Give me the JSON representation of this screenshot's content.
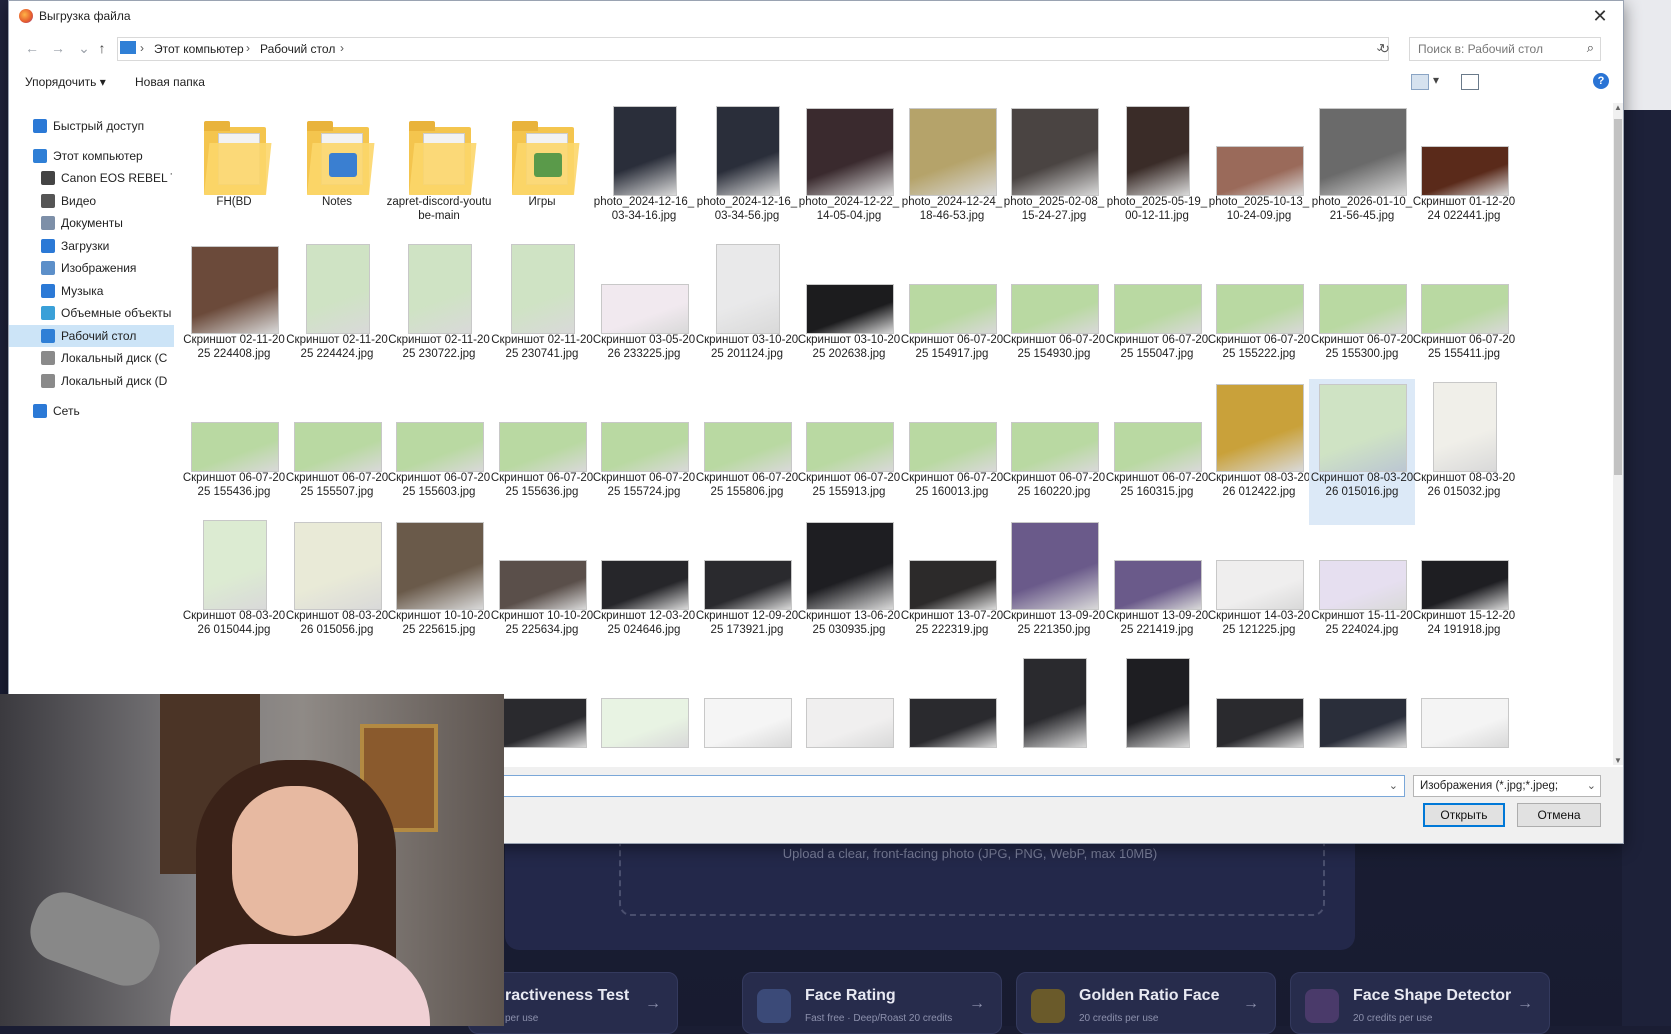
{
  "dialog": {
    "title": "Выгрузка файла",
    "close_label": "✕",
    "breadcrumb": [
      "Этот компьютер",
      "Рабочий стол"
    ],
    "search_placeholder": "Поиск в: Рабочий стол",
    "toolbar": {
      "organize": "Упорядочить",
      "new_folder": "Новая папка",
      "help": "?"
    },
    "nav": [
      {
        "label": "Быстрый доступ",
        "icon": "star-icon",
        "color": "#2b79d6"
      },
      {
        "label": "Этот компьютер",
        "icon": "computer-icon",
        "color": "#2f7fd6"
      },
      {
        "label": "Canon EOS REBEL T",
        "icon": "camera-icon",
        "color": "#444444"
      },
      {
        "label": "Видео",
        "icon": "video-icon",
        "color": "#555555"
      },
      {
        "label": "Документы",
        "icon": "documents-icon",
        "color": "#7d8fa8"
      },
      {
        "label": "Загрузки",
        "icon": "downloads-icon",
        "color": "#2b79d6"
      },
      {
        "label": "Изображения",
        "icon": "images-icon",
        "color": "#5c8fc9"
      },
      {
        "label": "Музыка",
        "icon": "music-icon",
        "color": "#2b79d6"
      },
      {
        "label": "Объемные объекты",
        "icon": "3d-objects-icon",
        "color": "#3aa0d8"
      },
      {
        "label": "Рабочий стол",
        "icon": "desktop-icon",
        "color": "#2f7fd6"
      },
      {
        "label": "Локальный диск (C",
        "icon": "drive-icon",
        "color": "#8a8a8a"
      },
      {
        "label": "Локальный диск (D",
        "icon": "drive-icon",
        "color": "#8a8a8a"
      },
      {
        "label": "Сеть",
        "icon": "network-icon",
        "color": "#2b79d6"
      }
    ],
    "files": [
      [
        {
          "name": "FH(BD",
          "kind": "folder"
        },
        {
          "name": "Notes",
          "kind": "folder",
          "badge": "#3a7fd1"
        },
        {
          "name": "zapret-discord-youtube-main",
          "kind": "folder"
        },
        {
          "name": "Игры",
          "kind": "folder",
          "badge": "#5a9a4a"
        },
        {
          "name": "photo_2024-12-16_03-34-16.jpg",
          "kind": "image",
          "color": "#2a2e3a",
          "shape": "tall"
        },
        {
          "name": "photo_2024-12-16_03-34-56.jpg",
          "kind": "image",
          "color": "#2a2e3a",
          "shape": "tall"
        },
        {
          "name": "photo_2024-12-22_14-05-04.jpg",
          "kind": "image",
          "color": "#3a2a2e",
          "shape": "square"
        },
        {
          "name": "photo_2024-12-24_18-46-53.jpg",
          "kind": "image",
          "color": "#b5a36a",
          "shape": "square"
        },
        {
          "name": "photo_2025-02-08_15-24-27.jpg",
          "kind": "image",
          "color": "#4a4442",
          "shape": "square"
        },
        {
          "name": "photo_2025-05-19_00-12-11.jpg",
          "kind": "image",
          "color": "#3a2c28",
          "shape": "tall"
        },
        {
          "name": "photo_2025-10-13_10-24-09.jpg",
          "kind": "image",
          "color": "#9a6a5a",
          "shape": "wide"
        },
        {
          "name": "photo_2026-01-10_21-56-45.jpg",
          "kind": "image",
          "color": "#6a6a6a",
          "shape": "square"
        },
        {
          "name": "Скриншот 01-12-2024 022441.jpg",
          "kind": "image",
          "color": "#5a2a1a",
          "shape": "wide"
        }
      ],
      [
        {
          "name": "Скриншот 02-11-2025 224408.jpg",
          "kind": "image",
          "color": "#6b4a3a",
          "shape": "square"
        },
        {
          "name": "Скриншот 02-11-2025 224424.jpg",
          "kind": "image",
          "color": "#cfe3c4",
          "shape": "tall"
        },
        {
          "name": "Скриншот 02-11-2025 230722.jpg",
          "kind": "image",
          "color": "#cfe3c4",
          "shape": "tall"
        },
        {
          "name": "Скриншот 02-11-2025 230741.jpg",
          "kind": "image",
          "color": "#cfe3c4",
          "shape": "tall"
        },
        {
          "name": "Скриншот 03-05-2026 233225.jpg",
          "kind": "image",
          "color": "#f1e9ef",
          "shape": "wide"
        },
        {
          "name": "Скриншот 03-10-2025 201124.jpg",
          "kind": "image",
          "color": "#e9e9ea",
          "shape": "tall"
        },
        {
          "name": "Скриншот 03-10-2025 202638.jpg",
          "kind": "image",
          "color": "#1c1c1e",
          "shape": "wide"
        },
        {
          "name": "Скриншот 06-07-2025 154917.jpg",
          "kind": "image",
          "color": "#b9d9a2",
          "shape": "wide"
        },
        {
          "name": "Скриншот 06-07-2025 154930.jpg",
          "kind": "image",
          "color": "#b9d9a2",
          "shape": "wide"
        },
        {
          "name": "Скриншот 06-07-2025 155047.jpg",
          "kind": "image",
          "color": "#b9d9a2",
          "shape": "wide"
        },
        {
          "name": "Скриншот 06-07-2025 155222.jpg",
          "kind": "image",
          "color": "#b9d9a2",
          "shape": "wide"
        },
        {
          "name": "Скриншот 06-07-2025 155300.jpg",
          "kind": "image",
          "color": "#b9d9a2",
          "shape": "wide"
        },
        {
          "name": "Скриншот 06-07-2025 155411.jpg",
          "kind": "image",
          "color": "#b9d9a2",
          "shape": "wide"
        }
      ],
      [
        {
          "name": "Скриншот 06-07-2025 155436.jpg",
          "kind": "image",
          "color": "#b9d9a2",
          "shape": "wide"
        },
        {
          "name": "Скриншот 06-07-2025 155507.jpg",
          "kind": "image",
          "color": "#b9d9a2",
          "shape": "wide"
        },
        {
          "name": "Скриншот 06-07-2025 155603.jpg",
          "kind": "image",
          "color": "#b9d9a2",
          "shape": "wide"
        },
        {
          "name": "Скриншот 06-07-2025 155636.jpg",
          "kind": "image",
          "color": "#b9d9a2",
          "shape": "wide"
        },
        {
          "name": "Скриншот 06-07-2025 155724.jpg",
          "kind": "image",
          "color": "#b9d9a2",
          "shape": "wide"
        },
        {
          "name": "Скриншот 06-07-2025 155806.jpg",
          "kind": "image",
          "color": "#b9d9a2",
          "shape": "wide"
        },
        {
          "name": "Скриншот 06-07-2025 155913.jpg",
          "kind": "image",
          "color": "#b9d9a2",
          "shape": "wide"
        },
        {
          "name": "Скриншот 06-07-2025 160013.jpg",
          "kind": "image",
          "color": "#b9d9a2",
          "shape": "wide"
        },
        {
          "name": "Скриншот 06-07-2025 160220.jpg",
          "kind": "image",
          "color": "#b9d9a2",
          "shape": "wide"
        },
        {
          "name": "Скриншот 06-07-2025 160315.jpg",
          "kind": "image",
          "color": "#b9d9a2",
          "shape": "wide"
        },
        {
          "name": "Скриншот 08-03-2026 012422.jpg",
          "kind": "image",
          "color": "#c9a13a",
          "shape": "square"
        },
        {
          "name": "Скриншот 08-03-2026 015016.jpg",
          "kind": "image",
          "color": "#cfe3c4",
          "shape": "square",
          "selected": true
        },
        {
          "name": "Скриншот 08-03-2026 015032.jpg",
          "kind": "image",
          "color": "#f0efe9",
          "shape": "tall"
        }
      ],
      [
        {
          "name": "Скриншот 08-03-2026 015044.jpg",
          "kind": "image",
          "color": "#dcebd2",
          "shape": "tall"
        },
        {
          "name": "Скриншот 08-03-2026 015056.jpg",
          "kind": "image",
          "color": "#e9ead7",
          "shape": "square"
        },
        {
          "name": "Скриншот 10-10-2025 225615.jpg",
          "kind": "image",
          "color": "#6a5a4a",
          "shape": "square"
        },
        {
          "name": "Скриншот 10-10-2025 225634.jpg",
          "kind": "image",
          "color": "#5a4f4a",
          "shape": "wide"
        },
        {
          "name": "Скриншот 12-03-2025 024646.jpg",
          "kind": "image",
          "color": "#26262a",
          "shape": "wide"
        },
        {
          "name": "Скриншот 12-09-2025 173921.jpg",
          "kind": "image",
          "color": "#2a2a2e",
          "shape": "wide"
        },
        {
          "name": "Скриншот 13-06-2025 030935.jpg",
          "kind": "image",
          "color": "#1e1e22",
          "shape": "square"
        },
        {
          "name": "Скриншот 13-07-2025 222319.jpg",
          "kind": "image",
          "color": "#2c2a2a",
          "shape": "wide"
        },
        {
          "name": "Скриншот 13-09-2025 221350.jpg",
          "kind": "image",
          "color": "#6a5a8a",
          "shape": "square"
        },
        {
          "name": "Скриншот 13-09-2025 221419.jpg",
          "kind": "image",
          "color": "#6a5a8a",
          "shape": "wide"
        },
        {
          "name": "Скриншот 14-03-2025 121225.jpg",
          "kind": "image",
          "color": "#efeeee",
          "shape": "wide"
        },
        {
          "name": "Скриншот 15-11-2025 224024.jpg",
          "kind": "image",
          "color": "#e6dff0",
          "shape": "wide"
        },
        {
          "name": "Скриншот 15-12-2024 191918.jpg",
          "kind": "image",
          "color": "#1e1e22",
          "shape": "wide"
        }
      ],
      [
        {
          "name": "",
          "kind": "image",
          "color": "#f4f4f4",
          "shape": "wide"
        },
        {
          "name": "",
          "kind": "image",
          "color": "#f4f4f4",
          "shape": "wide"
        },
        {
          "name": "",
          "kind": "image",
          "color": "#f4f4f4",
          "shape": "wide"
        },
        {
          "name": "",
          "kind": "image",
          "color": "#2a2a2e",
          "shape": "wide"
        },
        {
          "name": "",
          "kind": "image",
          "color": "#e8f3e3",
          "shape": "wide"
        },
        {
          "name": "",
          "kind": "image",
          "color": "#f5f5f5",
          "shape": "wide"
        },
        {
          "name": "",
          "kind": "image",
          "color": "#f0efef",
          "shape": "wide"
        },
        {
          "name": "",
          "kind": "image",
          "color": "#2a2a2e",
          "shape": "wide"
        },
        {
          "name": "",
          "kind": "image",
          "color": "#2a2a2e",
          "shape": "tall"
        },
        {
          "name": "",
          "kind": "image",
          "color": "#1e1e22",
          "shape": "tall"
        },
        {
          "name": "",
          "kind": "image",
          "color": "#2a2a2e",
          "shape": "wide"
        },
        {
          "name": "",
          "kind": "image",
          "color": "#2a2e3a",
          "shape": "wide"
        },
        {
          "name": "",
          "kind": "image",
          "color": "#f4f4f4",
          "shape": "wide"
        }
      ]
    ],
    "filename_value": "",
    "filter_value": "Изображения (*.jpg;*.jpeg;",
    "open_label": "Открыть",
    "cancel_label": "Отмена"
  },
  "app": {
    "upload_hint": "Upload a clear, front-facing photo (JPG, PNG, WebP, max 10MB)",
    "tools": [
      {
        "title": "ractiveness Test",
        "subtitle": "per use",
        "icon": "heart-icon",
        "icon_color": "#3b4170"
      },
      {
        "title": "Face Rating",
        "subtitle": "Fast free · Deep/Roast 20 credits",
        "icon": "scan-face-icon",
        "icon_color": "#3b4a78"
      },
      {
        "title": "Golden Ratio Face",
        "subtitle": "20 credits per use",
        "icon": "ratio-icon",
        "icon_color": "#6a5a2a"
      },
      {
        "title": "Face Shape Detector",
        "subtitle": "20 credits per use",
        "icon": "shapes-icon",
        "icon_color": "#4a3a6a"
      }
    ]
  },
  "colors": {
    "accent": "#0078d7",
    "selection": "#cce4f7",
    "app_bg": "#1d2139"
  }
}
